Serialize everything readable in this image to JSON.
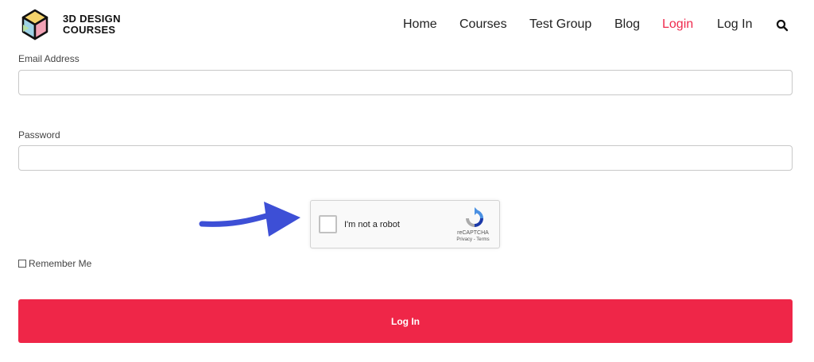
{
  "brand": {
    "line1": "3D DESIGN",
    "line2": "COURSES"
  },
  "nav": {
    "items": [
      {
        "label": "Home",
        "active": false
      },
      {
        "label": "Courses",
        "active": false
      },
      {
        "label": "Test Group",
        "active": false
      },
      {
        "label": "Blog",
        "active": false
      },
      {
        "label": "Login",
        "active": true
      },
      {
        "label": "Log In",
        "active": false
      }
    ],
    "active_color": "#ef2a4d"
  },
  "form": {
    "email_label": "Email Address",
    "email_value": "",
    "password_label": "Password",
    "password_value": "",
    "captcha": {
      "text": "I'm not a robot",
      "brand": "reCAPTCHA",
      "links": "Privacy - Terms"
    },
    "remember_label": "Remember Me",
    "submit_label": "Log In"
  },
  "colors": {
    "accent": "#ef2648",
    "arrow": "#3d4fd6"
  }
}
